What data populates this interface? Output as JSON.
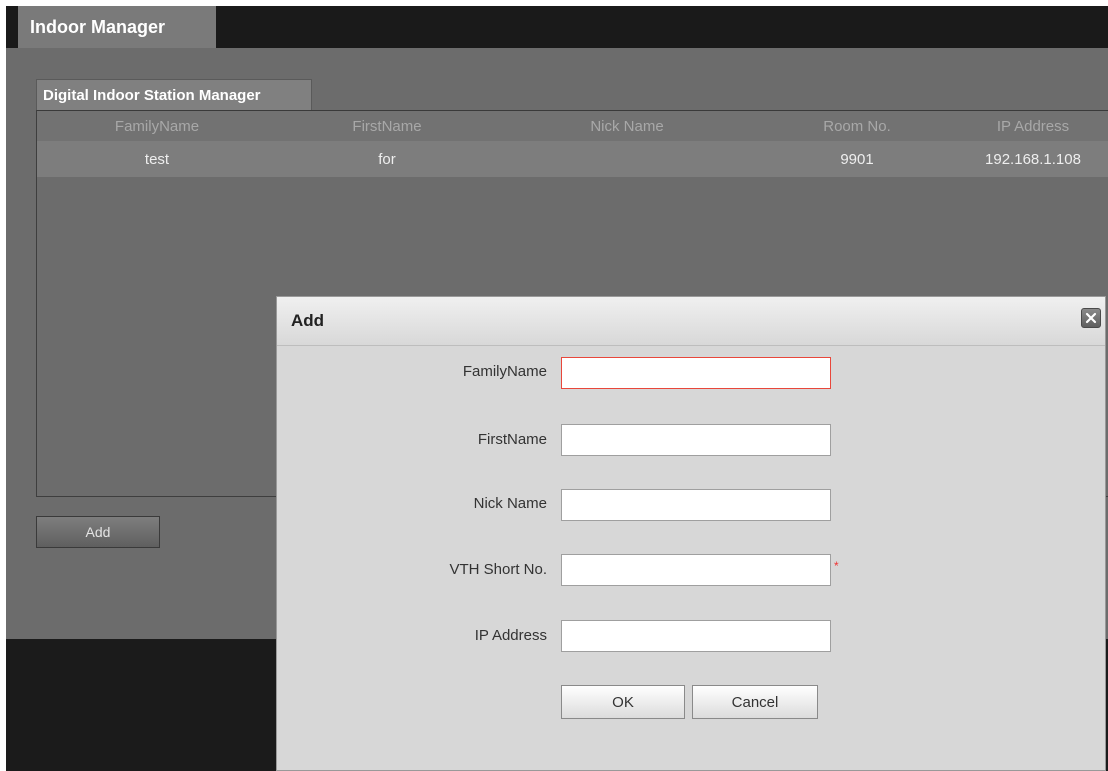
{
  "main_tab": {
    "label": "Indoor Manager"
  },
  "sub_tab": {
    "label": "Digital Indoor Station Manager"
  },
  "table": {
    "columns": [
      "FamilyName",
      "FirstName",
      "Nick Name",
      "Room No.",
      "IP Address"
    ],
    "rows": [
      [
        "test",
        "for",
        "",
        "9901",
        "192.168.1.108"
      ]
    ]
  },
  "add_button": {
    "label": "Add"
  },
  "dialog": {
    "title": "Add",
    "fields": [
      {
        "label": "FamilyName",
        "value": ""
      },
      {
        "label": "FirstName",
        "value": ""
      },
      {
        "label": "Nick Name",
        "value": ""
      },
      {
        "label": "VTH Short No.",
        "value": "",
        "required_mark": "*"
      },
      {
        "label": "IP Address",
        "value": ""
      }
    ],
    "ok_label": "OK",
    "cancel_label": "Cancel",
    "close_icon": "close-icon"
  },
  "colors": {
    "focus_border": "#e8473b",
    "required": "#ee3333"
  }
}
